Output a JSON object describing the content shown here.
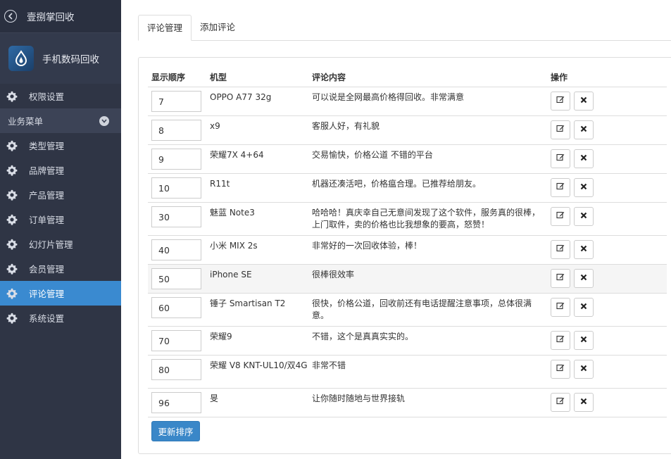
{
  "sidebar": {
    "title": "壹捌掌回收",
    "brand": "手机数码回收",
    "permission": "权限设置",
    "section": "业务菜单",
    "items": [
      {
        "label": "类型管理"
      },
      {
        "label": "品牌管理"
      },
      {
        "label": "产品管理"
      },
      {
        "label": "订单管理"
      },
      {
        "label": "幻灯片管理"
      },
      {
        "label": "会员管理"
      },
      {
        "label": "评论管理",
        "active": true
      },
      {
        "label": "系统设置"
      }
    ],
    "active_color": "#3a8ad0"
  },
  "tabs": [
    {
      "label": "评论管理",
      "active": true
    },
    {
      "label": "添加评论"
    }
  ],
  "table": {
    "headers": {
      "order": "显示顺序",
      "model": "机型",
      "content": "评论内容",
      "ops": "操作"
    },
    "rows": [
      {
        "order": "7",
        "model": "OPPO A77 32g",
        "content": "可以说是全网最高价格得回收。非常满意"
      },
      {
        "order": "8",
        "model": "x9",
        "content": "客服人好，有礼貌"
      },
      {
        "order": "9",
        "model": "荣耀7X 4+64",
        "content": "交易愉快，价格公道 不错的平台"
      },
      {
        "order": "10",
        "model": "R11t",
        "content": "机器还凑活吧，价格瘟合理。已推荐给朋友。"
      },
      {
        "order": "30",
        "model": "魅蓝 Note3",
        "content": "哈哈哈！真庆幸自己无意间发现了这个软件，服务真的很棒，上门取件，卖的价格也比我想象的要高，怒赞！"
      },
      {
        "order": "40",
        "model": "小米 MIX 2s",
        "content": "非常好的一次回收体验，棒！"
      },
      {
        "order": "50",
        "model": "iPhone SE",
        "content": "很棒很效率"
      },
      {
        "order": "60",
        "model": "锤子 Smartisan T2",
        "content": "很快，价格公道，回收前还有电话提醒注意事项，总体很满意。"
      },
      {
        "order": "70",
        "model": "荣耀9",
        "content": "不错，这个是真真实实的。"
      },
      {
        "order": "80",
        "model": "荣耀 V8 KNT-UL10/双4G",
        "content": "非常不错"
      },
      {
        "order": "96",
        "model": "旻",
        "content": "让你随时随地与世界接轨"
      }
    ]
  },
  "update_button": "更新排序",
  "icons": {
    "back": "chevron-left-circle-icon",
    "logo": "water-drop-icon",
    "menu": "gear-icon",
    "section": "chevron-down-icon",
    "edit": "edit-icon",
    "delete": "close-icon"
  }
}
